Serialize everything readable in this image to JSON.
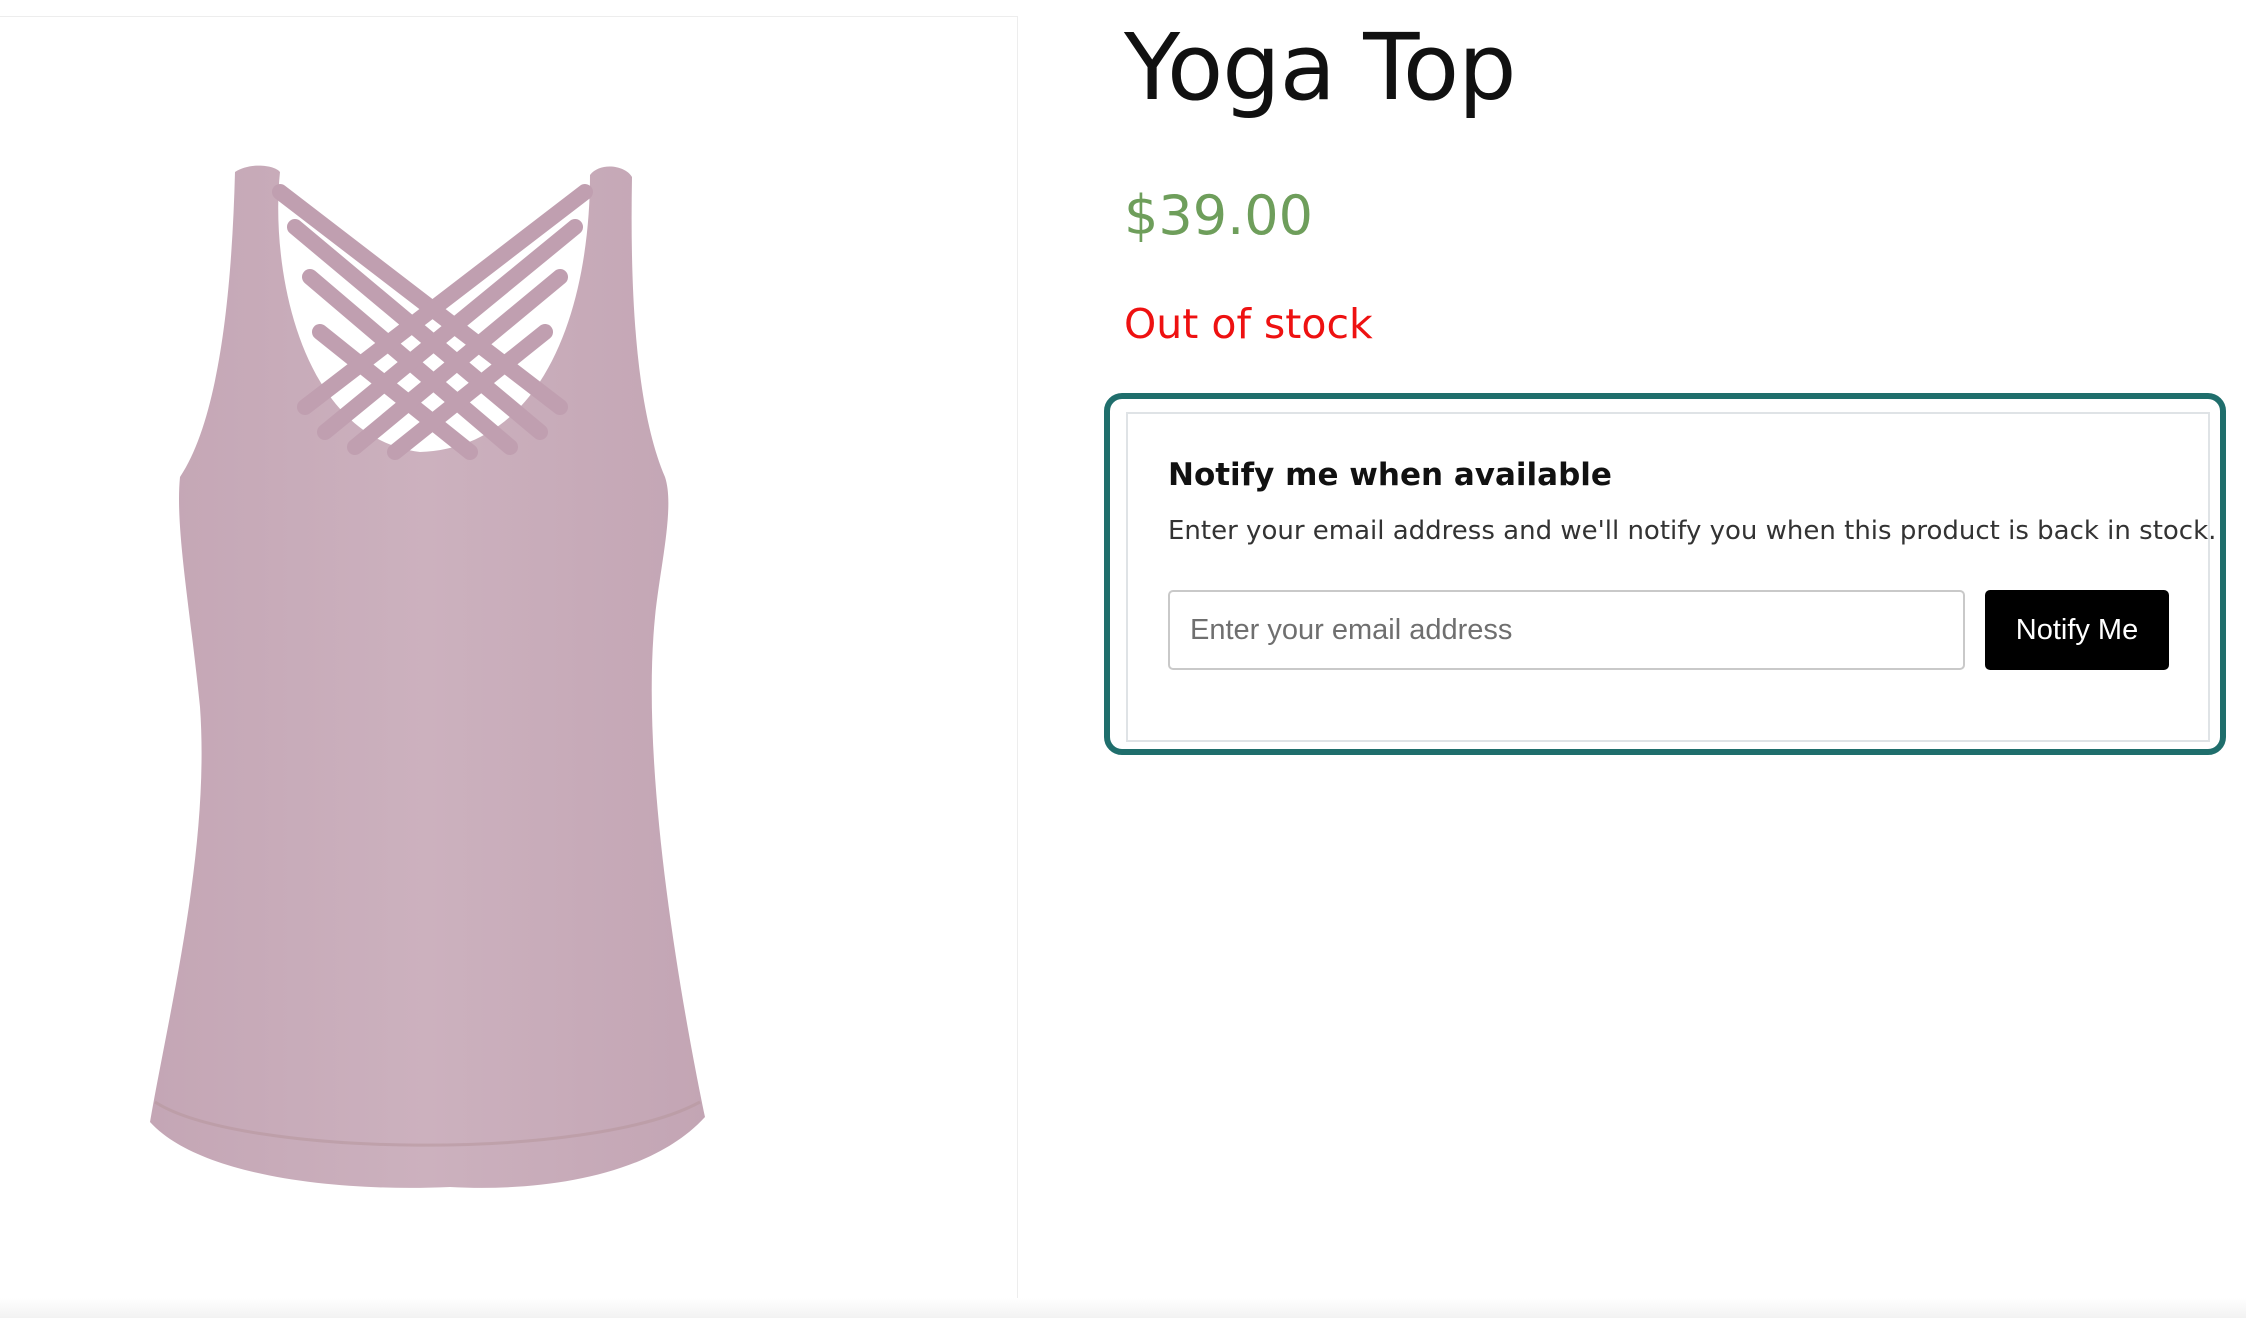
{
  "product": {
    "title": "Yoga Top",
    "price": "$39.00",
    "stock_status": "Out of stock",
    "image_alt": "Pink yoga tank top with criss-cross back straps",
    "image_color": "#c7aab8"
  },
  "notify": {
    "heading": "Notify me when available",
    "description": "Enter your email address and we'll notify you when this product is back in stock.",
    "email_value": "",
    "email_placeholder": "Enter your email address",
    "button_label": "Notify Me"
  },
  "colors": {
    "price": "#6e9e5b",
    "stock": "#ee1111",
    "highlight_outline": "#1f6e6c",
    "button_bg": "#000000"
  }
}
